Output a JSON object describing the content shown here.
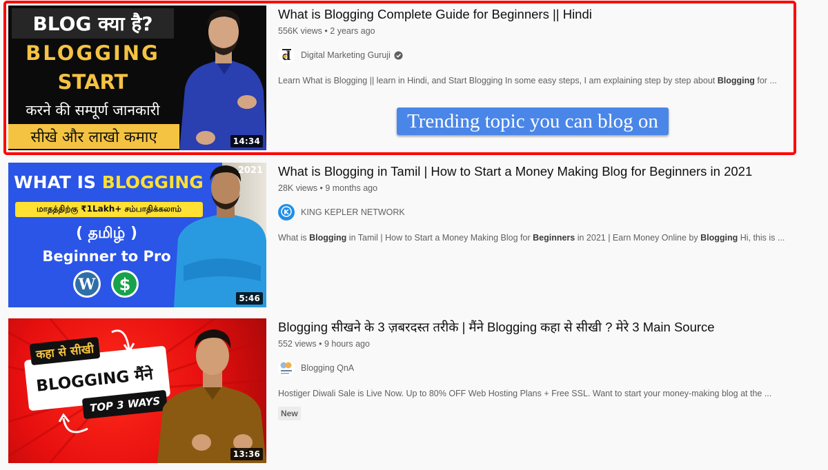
{
  "results": [
    {
      "title": "What is Blogging Complete Guide for Beginners || Hindi",
      "views": "556K views",
      "age": "2 years ago",
      "meta_separator": "•",
      "channel": "Digital Marketing Guruji",
      "channel_verified": true,
      "avatar_icon": "channel-logo-d",
      "description_parts": [
        {
          "text": "Learn What is Blogging || learn in Hindi, and Start Blogging In some easy steps, I am explaining step by step about ",
          "bold": false
        },
        {
          "text": "Blogging",
          "bold": true
        },
        {
          "text": " for ...",
          "bold": false
        }
      ],
      "duration": "14:34",
      "thumbnail": {
        "line1": "BLOG क्या है?",
        "line2": "BLOGGING",
        "line3": "START",
        "line4": "करने की सम्पूर्ण जानकारी",
        "line5": "सीखे और लाखो कमाए"
      },
      "highlighted": true
    },
    {
      "title": "What is Blogging in Tamil | How to Start a Money Making Blog for Beginners in 2021",
      "views": "28K views",
      "age": "9 months ago",
      "meta_separator": "•",
      "channel": "KING KEPLER NETWORK",
      "channel_verified": false,
      "avatar_icon": "channel-logo-k",
      "description_parts": [
        {
          "text": "What is ",
          "bold": false
        },
        {
          "text": "Blogging",
          "bold": true
        },
        {
          "text": " in Tamil | How to Start a Money Making Blog for ",
          "bold": false
        },
        {
          "text": "Beginners",
          "bold": true
        },
        {
          "text": " in 2021 | Earn Money Online by ",
          "bold": false
        },
        {
          "text": "Blogging",
          "bold": true
        },
        {
          "text": " Hi, this is ...",
          "bold": false
        }
      ],
      "duration": "5:46",
      "thumbnail": {
        "line1a": "WHAT IS ",
        "line1b": "BLOGGING",
        "line2": "மாதத்திற்கு ₹1Lakh+ சம்பாதிக்கலாம்",
        "line3": "( தமிழ் )",
        "line4": "Beginner to Pro",
        "year": "2021"
      }
    },
    {
      "title": "Blogging सीखने के 3 ज़बरदस्त तरीके | मैंने Blogging कहा से सीखी ? मेरे 3 Main Source",
      "views": "552 views",
      "age": "9 hours ago",
      "meta_separator": "•",
      "channel": "Blogging QnA",
      "channel_verified": false,
      "avatar_icon": "channel-logo-qna",
      "description_parts": [
        {
          "text": "Hostiger Diwali Sale is Live Now. Up to 80% OFF Web Hosting Plans + Free SSL. Want to start your money-making blog at the ...",
          "bold": false
        }
      ],
      "badge": "New",
      "duration": "13:36",
      "thumbnail": {
        "line1": "कहा से सीखी",
        "line2": "BLOGGING मैंने",
        "line3": "TOP 3 WAYS"
      }
    }
  ],
  "callout": {
    "text": "Trending topic you can blog on",
    "color": "#4a86e8"
  },
  "highlight_color": "#ff0000"
}
